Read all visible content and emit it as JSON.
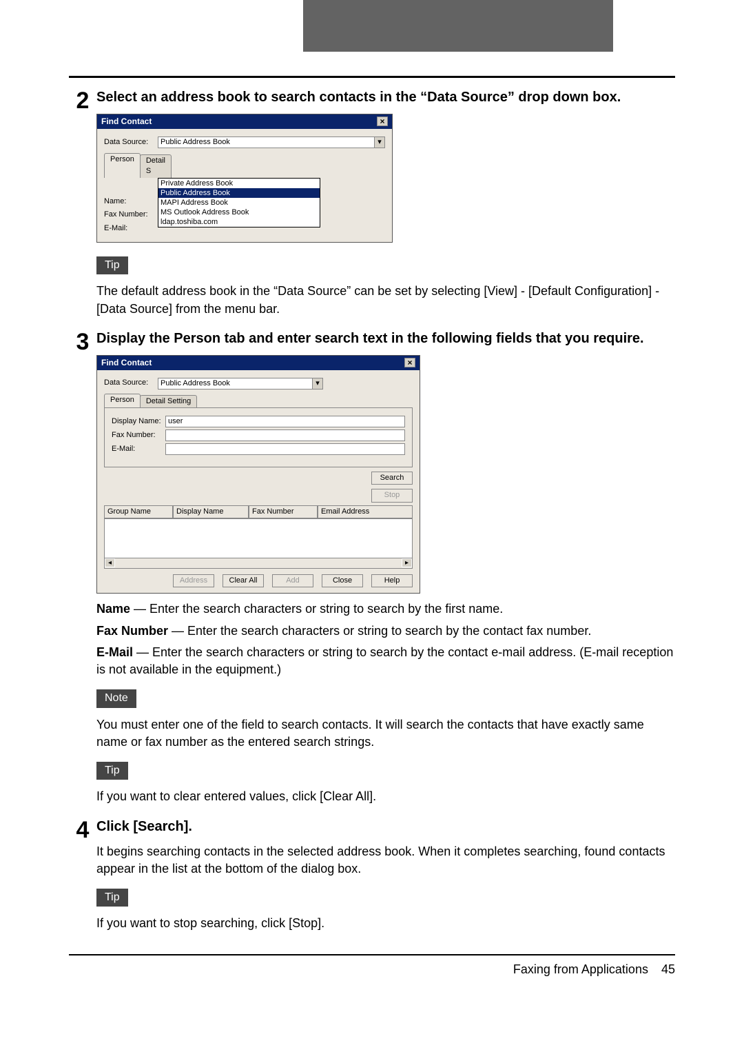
{
  "steps": {
    "s2": {
      "num": "2",
      "title": "Select an address book to search contacts in the “Data Source” drop down box."
    },
    "s3": {
      "num": "3",
      "title": "Display the Person tab and enter search text in the following fields that you require."
    },
    "s4": {
      "num": "4",
      "title": "Click [Search]."
    }
  },
  "badges": {
    "tip": "Tip",
    "note": "Note"
  },
  "tip2": "The default address book in the “Data Source” can be set by selecting [View] - [Default Configuration] - [Data Source] from the menu bar.",
  "name_label": "Name",
  "name_desc": " — Enter the search characters or string to search by the first name.",
  "fax_label": "Fax Number",
  "fax_desc": " — Enter the search characters or string to search by the contact fax number.",
  "email_label": "E-Mail",
  "email_desc": " — Enter the search characters or string to search by the contact e-mail address. (E-mail reception is not available in the equipment.)",
  "note3": "You must enter one of the field to search contacts. It will search the contacts that have exactly same name or fax number as the entered search strings.",
  "tip3": "If you want to clear entered values, click [Clear All].",
  "s4body": "It begins searching contacts in the selected address book. When it completes searching, found contacts appear in the list at the bottom of the dialog box.",
  "tip4": "If you want to stop searching, click [Stop].",
  "dialog1": {
    "title": "Find Contact",
    "data_source": "Data Source:",
    "tab_person": "Person",
    "tab_detail": "Detail S",
    "name": "Name:",
    "fax": "Fax Number:",
    "email": "E-Mail:",
    "selected": "Public Address Book",
    "options": [
      "Private Address Book",
      "Public Address Book",
      "MAPI Address Book",
      "MS Outlook Address Book",
      "ldap.toshiba.com"
    ]
  },
  "dialog2": {
    "title": "Find Contact",
    "data_source": "Data Source:",
    "tab_person": "Person",
    "tab_detail": "Detail Setting",
    "dispname": "Display Name:",
    "fax": "Fax Number:",
    "email": "E-Mail:",
    "selected": "Public Address Book",
    "display_value": "user",
    "search": "Search",
    "stop": "Stop",
    "col_group": "Group Name",
    "col_disp": "Display Name",
    "col_fax": "Fax Number",
    "col_email": "Email Address",
    "btn_address": "Address",
    "btn_clear": "Clear All",
    "btn_add": "Add",
    "btn_close": "Close",
    "btn_help": "Help"
  },
  "footer": {
    "text": "Faxing from Applications",
    "page": "45"
  }
}
